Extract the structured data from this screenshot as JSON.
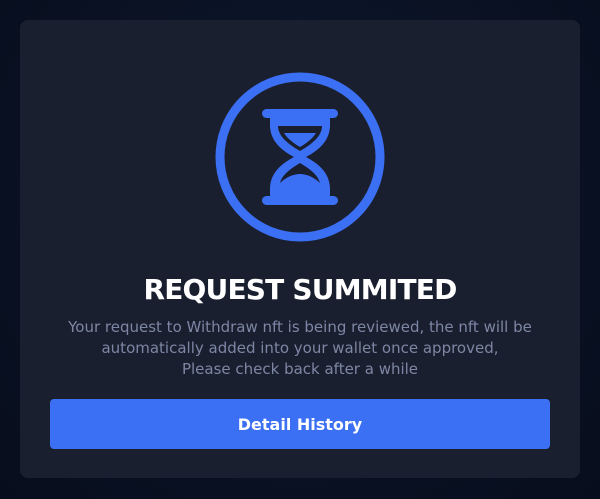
{
  "modal": {
    "icon": "hourglass-icon",
    "title": "REQUEST SUMMITED",
    "message_lines": [
      "Your request to Withdraw nft is being reviewed, the nft will be",
      "automatically added into your wallet once approved,",
      "Please check back after a while"
    ],
    "button_label": "Detail History"
  },
  "colors": {
    "accent": "#3c70f4",
    "modal_bg": "#1a1f30",
    "page_bg": "#0a1224",
    "message_text": "#7d86a3",
    "title_text": "#ffffff"
  }
}
